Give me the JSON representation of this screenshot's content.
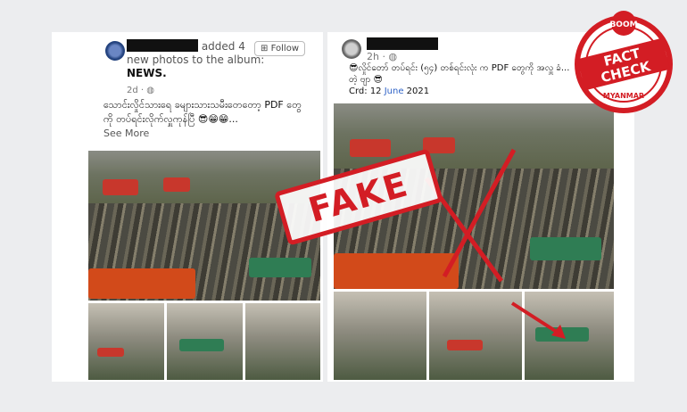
{
  "left_post": {
    "header_text": "added 4 new photos to the album:",
    "album": "NEWS.",
    "time": "2d ·",
    "follow_label": "Follow",
    "caption": "သောင်းလှိုင်သားရေ ခများသားသမီးတေတော့ PDF တွေကို တပ်ရင်းလိုက်လှူကုန်ပြီ 😎😁😁...",
    "see_more": "See More"
  },
  "right_post": {
    "time": "2h ·",
    "caption": "😎လှိုင်တော် တပ်ရင်း (၅၄) တစ်ရင်းလုံး က PDF တွေကို အလှူ ခံ... တဲ့ ဗျာ 😎",
    "credit_prefix": "Crd: 12 ",
    "credit_month": "June",
    "credit_year": " 2021"
  },
  "stamp": {
    "label": "FAKE"
  },
  "badge": {
    "top": "BOOM",
    "main_1": "FACT",
    "main_2": "CHECK",
    "bottom": "MYANMAR"
  },
  "colors": {
    "accent_red": "#d31d24",
    "link_blue": "#2f63c7"
  }
}
